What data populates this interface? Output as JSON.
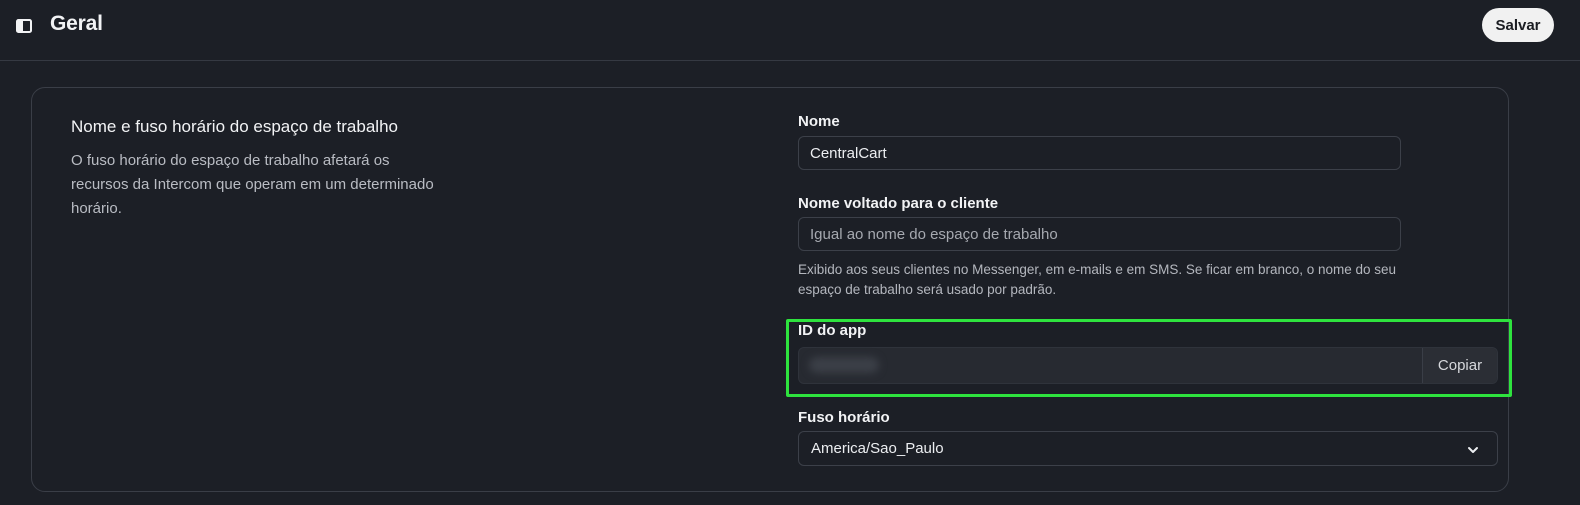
{
  "header": {
    "title": "Geral",
    "save_label": "Salvar",
    "sidebar_toggle_icon": "sidebar-toggle-icon"
  },
  "section": {
    "title": "Nome e fuso horário do espaço de trabalho",
    "description": "O fuso horário do espaço de trabalho afetará os recursos da Intercom que operam em um determinado horário."
  },
  "fields": {
    "name": {
      "label": "Nome",
      "value": "CentralCart"
    },
    "customer_name": {
      "label": "Nome voltado para o cliente",
      "value": "",
      "placeholder": "Igual ao nome do espaço de trabalho",
      "help": "Exibido aos seus clientes no Messenger, em e-mails e em SMS. Se ficar em branco, o nome do seu espaço de trabalho será usado por padrão."
    },
    "app_id": {
      "label": "ID do app",
      "copy_label": "Copiar"
    },
    "timezone": {
      "label": "Fuso horário",
      "value": "America/Sao_Paulo"
    }
  },
  "colors": {
    "background": "#1c1f26",
    "highlight": "#2ee33e",
    "save_button_bg": "#f1f1f1"
  }
}
